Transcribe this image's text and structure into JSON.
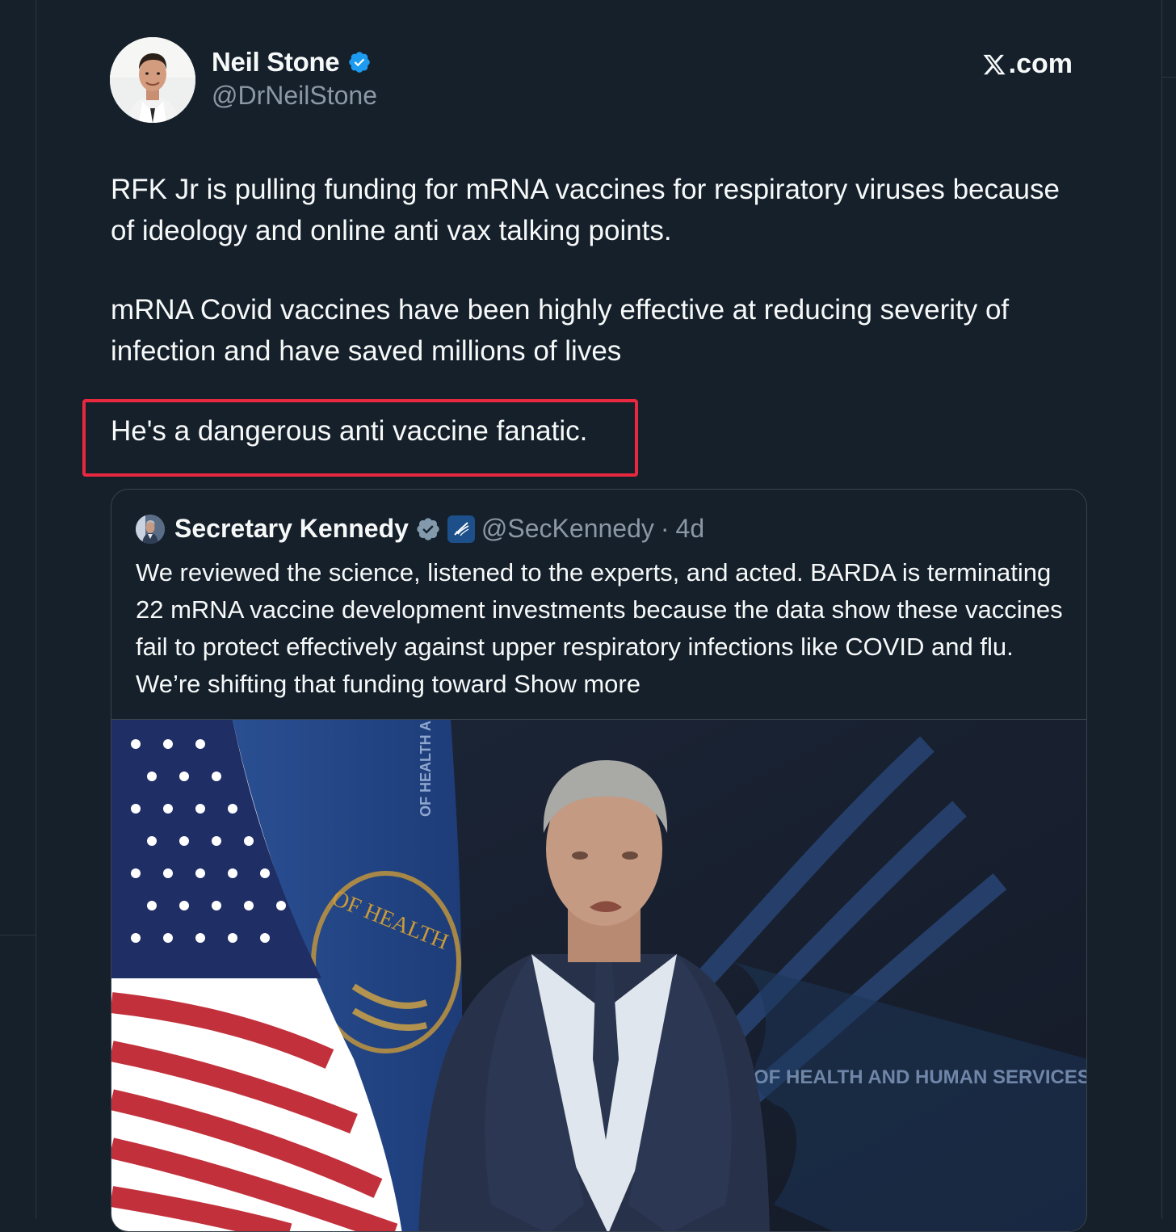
{
  "brand": {
    "label": ".com",
    "logo_icon": "x-logo-icon"
  },
  "author": {
    "name": "Neil Stone",
    "handle": "@DrNeilStone",
    "verified": true,
    "avatar_icon": "author-avatar"
  },
  "tweet": {
    "paragraphs": [
      "RFK Jr is pulling funding for mRNA vaccines for respiratory viruses because of ideology and online anti vax talking points.",
      "mRNA Covid vaccines have been highly effective at reducing severity of infection and have saved millions of lives",
      "He's a dangerous anti vaccine fanatic."
    ],
    "highlight_color": "#e8283f"
  },
  "quoted_tweet": {
    "name": "Secretary Kennedy",
    "handle": "@SecKennedy",
    "separator": "·",
    "time": "4d",
    "body": "We reviewed the science, listened to the experts, and acted. BARDA is terminating 22 mRNA vaccine development investments because the data show these vaccines fail to protect effectively against upper respiratory infections like COVID and flu. We’re shifting that funding toward",
    "show_more": "Show more",
    "media": {
      "banner_text": "OF HEALTH AND HUMAN SERVICES",
      "flag_text": "OF HEALTH AN",
      "seal_text": "OF HEALTH"
    }
  },
  "colors": {
    "background": "#15202b",
    "text": "#f7f9f9",
    "secondary_text": "#8b98a5",
    "verified_blue": "#1d9bf0",
    "gov_grey": "#829aab"
  }
}
